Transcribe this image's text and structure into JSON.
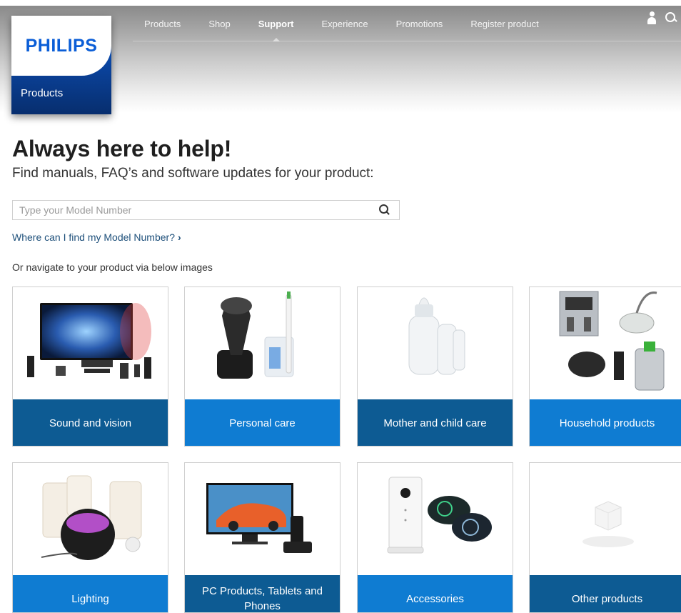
{
  "nav": {
    "items": [
      "Products",
      "Shop",
      "Support",
      "Experience",
      "Promotions",
      "Register product"
    ],
    "active": "Support"
  },
  "logo": {
    "brand": "PHILIPS",
    "section": "Products"
  },
  "main": {
    "headline": "Always here to help!",
    "subhead": "Find manuals, FAQ’s and software updates for your product:",
    "search_placeholder": "Type your Model Number",
    "model_link": "Where can I find my Model Number?",
    "navigate_hint": "Or navigate to your product via below images"
  },
  "tiles": [
    {
      "label": "Sound and vision",
      "icon": "tv-home-theater-image"
    },
    {
      "label": "Personal care",
      "icon": "shaver-toothbrush-image"
    },
    {
      "label": "Mother and child care",
      "icon": "baby-bottles-image"
    },
    {
      "label": "Household products",
      "icon": "household-appliances-image"
    },
    {
      "label": "Lighting",
      "icon": "lamps-image"
    },
    {
      "label": "PC Products, Tablets and Phones",
      "icon": "monitor-phone-image"
    },
    {
      "label": "Accessories",
      "icon": "camera-shaver-heads-image"
    },
    {
      "label": "Other products",
      "icon": "cube-image"
    }
  ],
  "colors": {
    "brand_blue": "#0b5ed7",
    "tile_dark": "#0d5b93",
    "tile_light": "#0f7cd2",
    "link": "#1d4f7a"
  }
}
